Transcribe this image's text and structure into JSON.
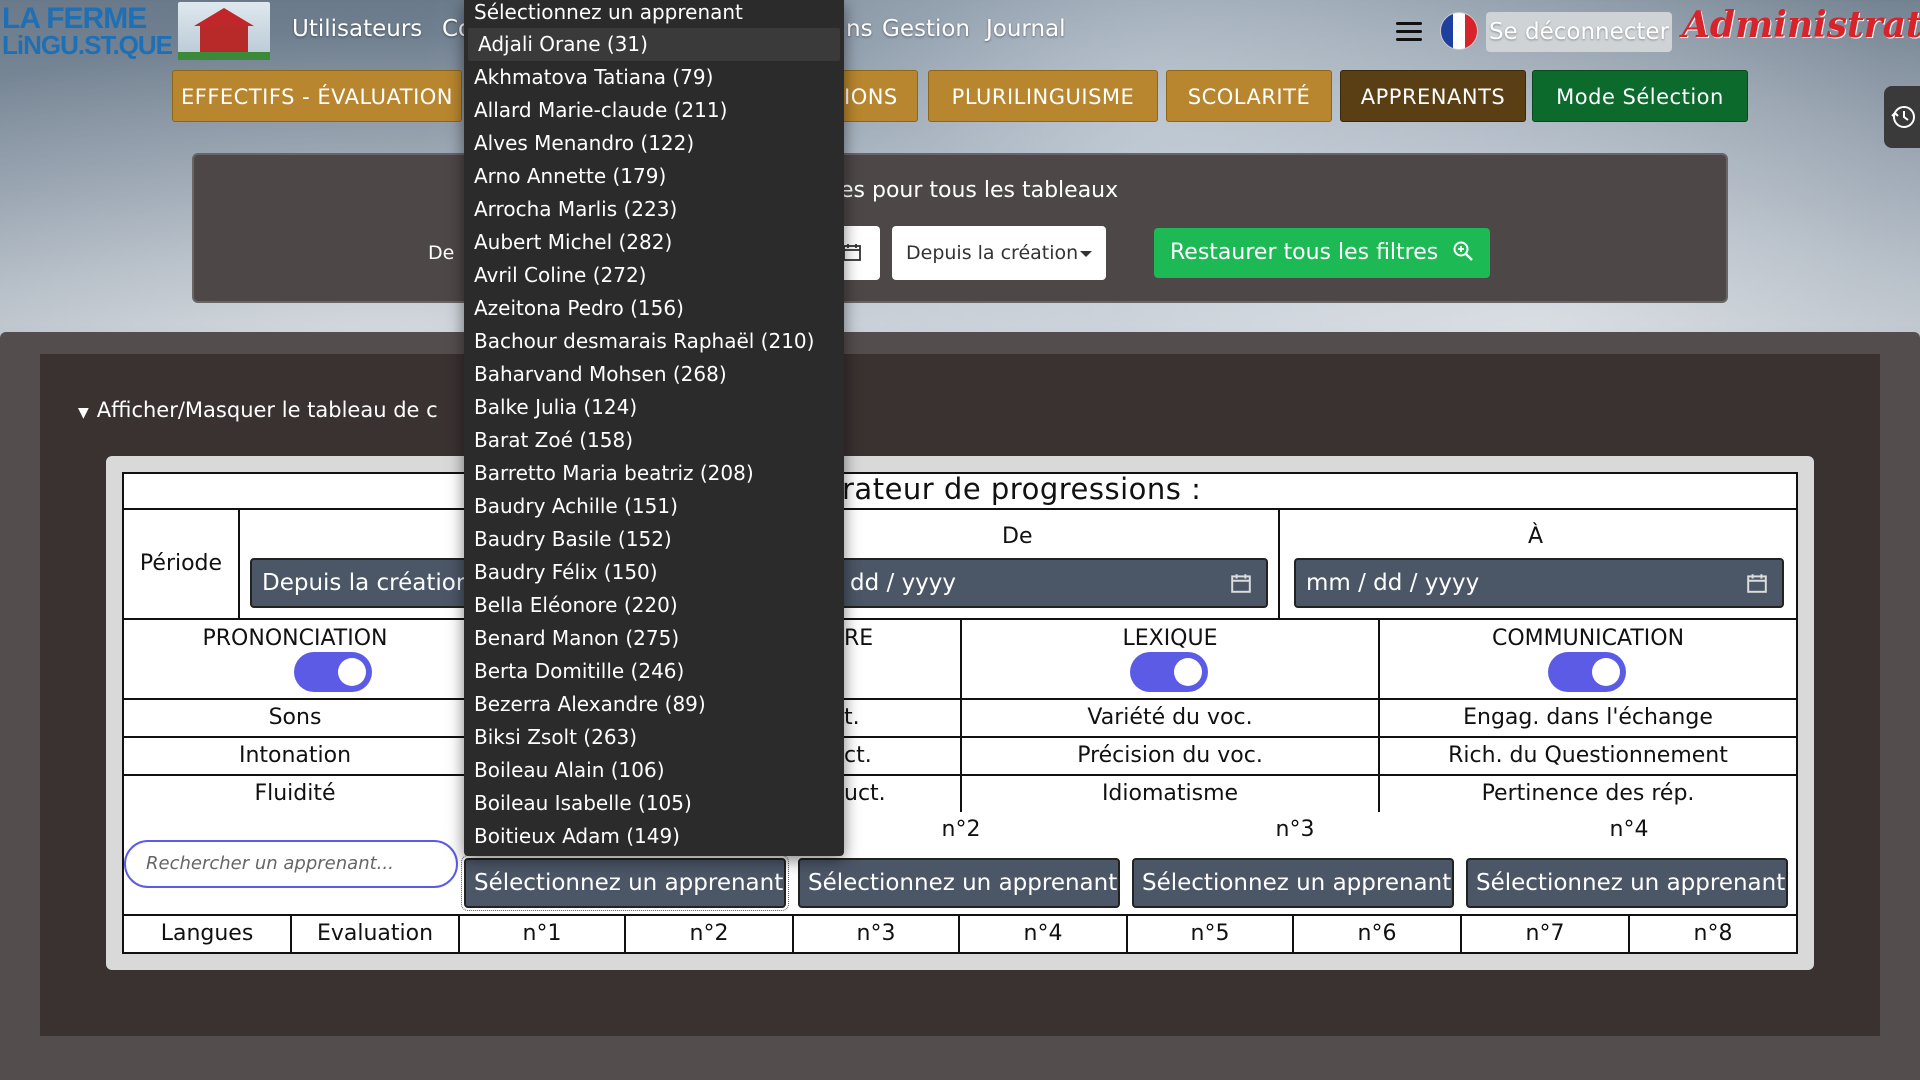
{
  "nav": {
    "logo_line1": "LA FERME",
    "logo_line2": "LiNGU.ST.QUE",
    "links": [
      "Utilisateurs",
      "Co",
      "ns",
      "Gestion",
      "Journal"
    ],
    "logout_label": "Se déconnecter",
    "role_label": "Administrateur"
  },
  "sections": {
    "effectifs": "EFFECTIFS - ÉVALUATION",
    "actions_fragment": "IONS",
    "plurilinguisme": "PLURILINGUISME",
    "scolarite": "SCOLARITÉ",
    "apprenants": "APPRENANTS",
    "mode_selection": "Mode Sélection"
  },
  "filters": {
    "title_fragment": "es pour tous les tableaux",
    "de_label": "De",
    "period_value": "Depuis la création",
    "restore_label": "Restaurer tous les filtres"
  },
  "main": {
    "toggle_label": "Afficher/Masquer le tableau de c",
    "table_title_fragment": "rateur de progressions :",
    "periode_label": "Période",
    "periode_value": "Depuis la création",
    "de_header": "De",
    "a_header": "À",
    "date_placeholder_partial": "dd / yyyy",
    "date_placeholder": "mm / dd / yyyy",
    "categories": [
      "PRONONCIATION",
      "RE",
      "LEXIQUE",
      "COMMUNICATION"
    ],
    "rows": [
      [
        "Sons",
        "t.",
        "Variété du voc.",
        "Engag. dans l'échange"
      ],
      [
        "Intonation",
        "ct.",
        "Précision du voc.",
        "Rich. du Questionnement"
      ],
      [
        "Fluidité",
        "uct.",
        "Idiomatisme",
        "Pertinence des rép."
      ]
    ],
    "search_placeholder": "Rechercher un apprenant...",
    "slots": [
      "n°2",
      "n°3",
      "n°4"
    ],
    "slot_select_label": "Sélectionnez un apprenant",
    "footer_headers": [
      "Langues",
      "Evaluation",
      "n°1",
      "n°2",
      "n°3",
      "n°4",
      "n°5",
      "n°6",
      "n°7",
      "n°8"
    ]
  },
  "dropdown": {
    "header": "Sélectionnez un apprenant",
    "options": [
      "Adjali Orane (31)",
      "Akhmatova Tatiana (79)",
      "Allard Marie-claude (211)",
      "Alves Menandro (122)",
      "Arno Annette (179)",
      "Arrocha Marlis (223)",
      "Aubert Michel (282)",
      "Avril Coline (272)",
      "Azeitona Pedro (156)",
      "Bachour desmarais Raphaël (210)",
      "Baharvand Mohsen (268)",
      "Balke Julia (124)",
      "Barat Zoé (158)",
      "Barretto Maria beatriz (208)",
      "Baudry Achille (151)",
      "Baudry Basile (152)",
      "Baudry Félix (150)",
      "Bella Eléonore (220)",
      "Benard Manon (275)",
      "Berta Domitille (246)",
      "Bezerra Alexandre (89)",
      "Biksi Zsolt (263)",
      "Boileau Alain (106)",
      "Boileau Isabelle (105)",
      "Boitieux Adam (149)"
    ],
    "selected_option": "Adjali Orane (31)"
  },
  "colors": {
    "gold": "#b8862e",
    "dark_brown": "#5a3e14",
    "green": "#0b6a2c",
    "restore_green": "#1db954",
    "toggle_purple": "#5b5be6",
    "admin_red": "#d8232a"
  },
  "icons": [
    "hamburger-icon",
    "french-flag-icon",
    "history-icon",
    "calendar-icon",
    "search-zoom-icon",
    "caret-down-icon",
    "triangle-down-icon"
  ]
}
